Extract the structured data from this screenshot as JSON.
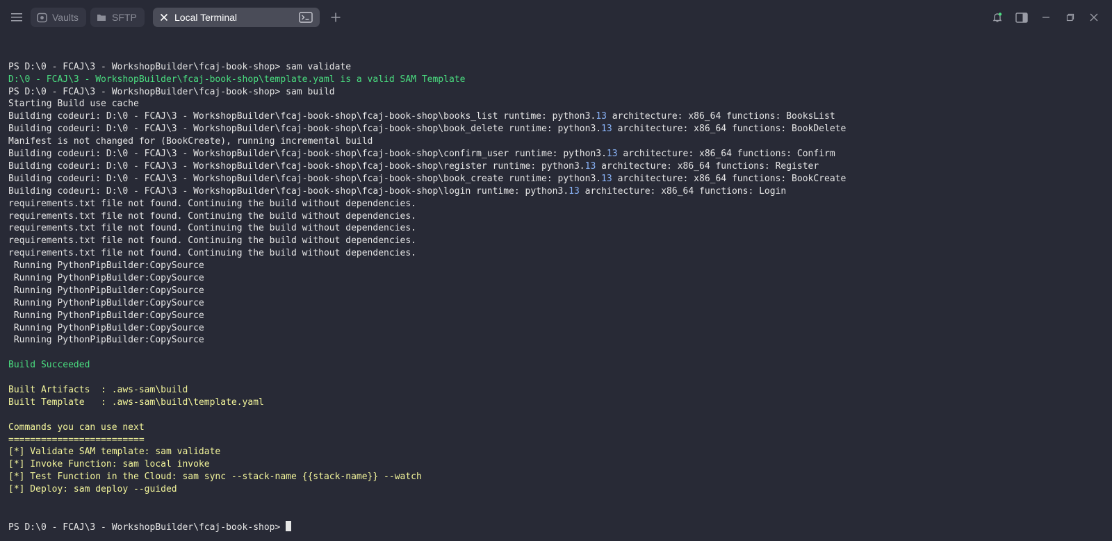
{
  "window": {
    "tabs": [
      {
        "label": "Vaults",
        "icon": "vault-icon"
      },
      {
        "label": "SFTP",
        "icon": "folder-icon"
      },
      {
        "label": "Local Terminal",
        "icon": "close-icon",
        "active": true
      }
    ],
    "controls": [
      "bell-icon",
      "sidebar-toggle-icon",
      "minimize-icon",
      "restore-icon",
      "close-icon"
    ]
  },
  "terminal": {
    "prompt_prefix": "PS D:\\0 - FCAJ\\3 - WorkshopBuilder\\fcaj-book-shop> ",
    "lines": [
      {
        "text": "PS D:\\0 - FCAJ\\3 - WorkshopBuilder\\fcaj-book-shop> sam validate",
        "color": "default"
      },
      {
        "text": "D:\\0 - FCAJ\\3 - WorkshopBuilder\\fcaj-book-shop\\template.yaml is a valid SAM Template",
        "color": "green"
      },
      {
        "text": "PS D:\\0 - FCAJ\\3 - WorkshopBuilder\\fcaj-book-shop> sam build",
        "color": "default"
      },
      {
        "text": "Starting Build use cache",
        "color": "default"
      },
      {
        "text": "Building codeuri: D:\\0 - FCAJ\\3 - WorkshopBuilder\\fcaj-book-shop\\fcaj-book-shop\\books_list runtime: python3.13 architecture: x86_64 functions: BooksList",
        "color": "default"
      },
      {
        "text": "Building codeuri: D:\\0 - FCAJ\\3 - WorkshopBuilder\\fcaj-book-shop\\fcaj-book-shop\\book_delete runtime: python3.13 architecture: x86_64 functions: BookDelete",
        "color": "default"
      },
      {
        "text": "Manifest is not changed for (BookCreate), running incremental build",
        "color": "default"
      },
      {
        "text": "Building codeuri: D:\\0 - FCAJ\\3 - WorkshopBuilder\\fcaj-book-shop\\fcaj-book-shop\\confirm_user runtime: python3.13 architecture: x86_64 functions: Confirm",
        "color": "default"
      },
      {
        "text": "Building codeuri: D:\\0 - FCAJ\\3 - WorkshopBuilder\\fcaj-book-shop\\fcaj-book-shop\\register runtime: python3.13 architecture: x86_64 functions: Register",
        "color": "default"
      },
      {
        "text": "Building codeuri: D:\\0 - FCAJ\\3 - WorkshopBuilder\\fcaj-book-shop\\fcaj-book-shop\\book_create runtime: python3.13 architecture: x86_64 functions: BookCreate",
        "color": "default"
      },
      {
        "text": "Building codeuri: D:\\0 - FCAJ\\3 - WorkshopBuilder\\fcaj-book-shop\\fcaj-book-shop\\login runtime: python3.13 architecture: x86_64 functions: Login",
        "color": "default"
      },
      {
        "text": "requirements.txt file not found. Continuing the build without dependencies.",
        "color": "default"
      },
      {
        "text": "requirements.txt file not found. Continuing the build without dependencies.",
        "color": "default"
      },
      {
        "text": "requirements.txt file not found. Continuing the build without dependencies.",
        "color": "default"
      },
      {
        "text": "requirements.txt file not found. Continuing the build without dependencies.",
        "color": "default"
      },
      {
        "text": "requirements.txt file not found. Continuing the build without dependencies.",
        "color": "default"
      },
      {
        "text": " Running PythonPipBuilder:CopySource",
        "color": "default"
      },
      {
        "text": " Running PythonPipBuilder:CopySource",
        "color": "default"
      },
      {
        "text": " Running PythonPipBuilder:CopySource",
        "color": "default"
      },
      {
        "text": " Running PythonPipBuilder:CopySource",
        "color": "default"
      },
      {
        "text": " Running PythonPipBuilder:CopySource",
        "color": "default"
      },
      {
        "text": " Running PythonPipBuilder:CopySource",
        "color": "default"
      },
      {
        "text": " Running PythonPipBuilder:CopySource",
        "color": "default"
      },
      {
        "text": "",
        "color": "default"
      },
      {
        "text": "Build Succeeded",
        "color": "green"
      },
      {
        "text": "",
        "color": "default"
      },
      {
        "text": "Built Artifacts  : .aws-sam\\build",
        "color": "yellow"
      },
      {
        "text": "Built Template   : .aws-sam\\build\\template.yaml",
        "color": "yellow"
      },
      {
        "text": "",
        "color": "default"
      },
      {
        "text": "Commands you can use next",
        "color": "yellow"
      },
      {
        "text": "=========================",
        "color": "yellow"
      },
      {
        "text": "[*] Validate SAM template: sam validate",
        "color": "yellow"
      },
      {
        "text": "[*] Invoke Function: sam local invoke",
        "color": "yellow"
      },
      {
        "text": "[*] Test Function in the Cloud: sam sync --stack-name {{stack-name}} --watch",
        "color": "yellow"
      },
      {
        "text": "[*] Deploy: sam deploy --guided",
        "color": "yellow"
      }
    ]
  },
  "colors": {
    "background": "#282a36",
    "default_text": "#e6e6e6",
    "green": "#4ade80",
    "yellow": "#f3f59b",
    "number_accent": "#8ab4f8"
  }
}
